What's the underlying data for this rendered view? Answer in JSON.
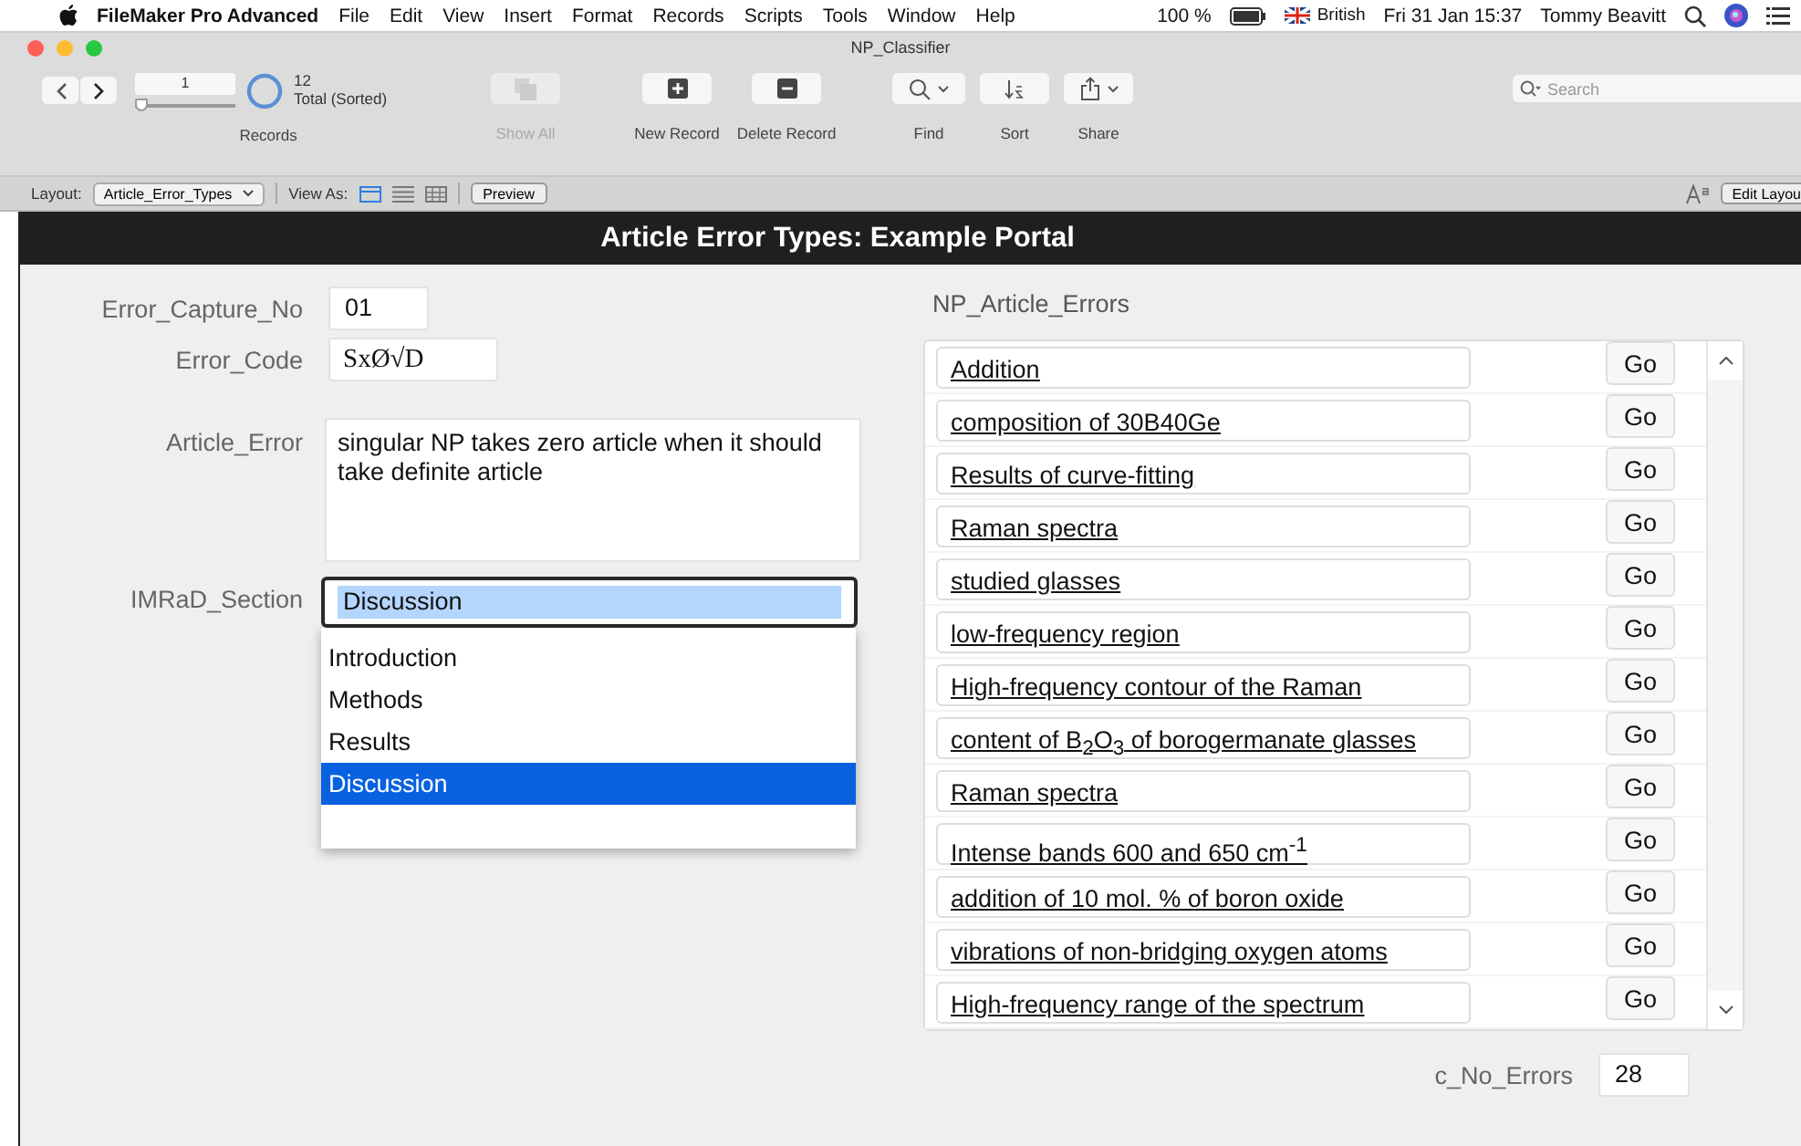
{
  "menu_bar": {
    "app": "FileMaker Pro Advanced",
    "menus": [
      "File",
      "Edit",
      "View",
      "Insert",
      "Format",
      "Records",
      "Scripts",
      "Tools",
      "Window",
      "Help"
    ],
    "battery": "100 %",
    "input_source": "British",
    "clock": "Fri 31 Jan 15:37",
    "user": "Tommy Beavitt"
  },
  "window": {
    "title": "NP_Classifier"
  },
  "toolbar": {
    "record": {
      "value": "1",
      "level": 0
    },
    "found": {
      "count": "12",
      "status": "Total (Sorted)"
    },
    "records_label": "Records",
    "buttons": [
      {
        "kind": "show-all",
        "label": "Show All",
        "disabled": true
      },
      {
        "kind": "new",
        "label": "New Record",
        "disabled": false
      },
      {
        "kind": "delete",
        "label": "Delete Record",
        "disabled": false
      },
      {
        "kind": "find",
        "label": "Find",
        "disabled": false
      },
      {
        "kind": "sort",
        "label": "Sort",
        "disabled": false
      },
      {
        "kind": "share",
        "label": "Share",
        "disabled": false
      }
    ],
    "search": {
      "placeholder": "Search"
    }
  },
  "layout_bar": {
    "layout_label": "Layout:",
    "layout": "Article_Error_Types",
    "view_as_label": "View As:",
    "views": [
      {
        "kind": "form",
        "selected": true
      },
      {
        "kind": "list",
        "selected": false
      },
      {
        "kind": "table",
        "selected": false
      }
    ],
    "preview": "Preview",
    "edit_layout": "Edit Layou"
  },
  "header": "Article Error Types: Example Portal",
  "fields": [
    {
      "kind": "text",
      "label": "Error_Capture_No",
      "value": "01"
    },
    {
      "kind": "code",
      "label": "Error_Code",
      "value": "SxØ√D"
    },
    {
      "kind": "area",
      "label": "Article_Error",
      "value": "singular NP takes zero article when it should take definite article"
    },
    {
      "kind": "dropdown",
      "label": "IMRaD_Section",
      "value": "Discussion",
      "options": [
        {
          "label": "Introduction",
          "selected": false
        },
        {
          "label": "Methods",
          "selected": false
        },
        {
          "label": "Results",
          "selected": false
        },
        {
          "label": "Discussion",
          "selected": true
        }
      ]
    }
  ],
  "portal": {
    "title": "NP_Article_Errors",
    "rows": [
      {
        "text": "Addition",
        "button": "Go"
      },
      {
        "text": "composition of 30B40Ge",
        "button": "Go"
      },
      {
        "text": "Results of curve-fitting",
        "button": "Go"
      },
      {
        "text": "Raman spectra",
        "button": "Go"
      },
      {
        "text": "studied glasses",
        "button": "Go"
      },
      {
        "text": "low-frequency region",
        "button": "Go"
      },
      {
        "text": "High-frequency contour of the Raman",
        "button": "Go"
      },
      {
        "text": "content of B$_{2}$O$_{3}$ of borogermanate glasses",
        "button": "Go"
      },
      {
        "text": "Raman spectra",
        "button": "Go"
      },
      {
        "text": "Intense bands 600 and 650 cm$^{-1}$",
        "button": "Go"
      },
      {
        "text": "addition of 10 mol. % of boron oxide",
        "button": "Go"
      },
      {
        "text": "vibrations of non-bridging oxygen atoms",
        "button": "Go"
      },
      {
        "text": "High-frequency range of the spectrum",
        "button": "Go"
      }
    ]
  },
  "count_field": {
    "label": "c_No_Errors",
    "value": "28"
  }
}
